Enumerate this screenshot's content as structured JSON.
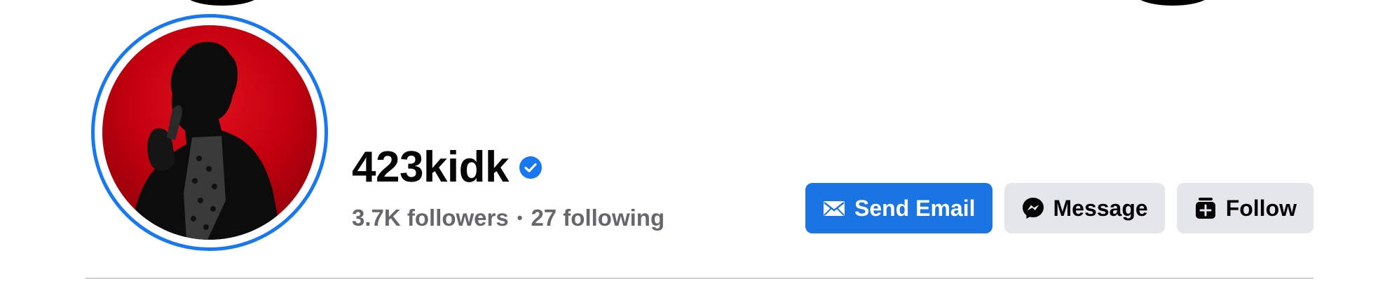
{
  "profile": {
    "name": "423kidk",
    "verified_icon": "verified-badge-icon",
    "followers": "3.7K followers",
    "separator": "•",
    "following": "27 following"
  },
  "actions": {
    "send_email": {
      "label": "Send Email",
      "icon": "envelope-icon"
    },
    "message": {
      "label": "Message",
      "icon": "messenger-icon"
    },
    "follow": {
      "label": "Follow",
      "icon": "follow-icon"
    }
  },
  "colors": {
    "accent": "#1b74e4",
    "ring": "#1877f2",
    "secondary_button": "#e4e6eb",
    "muted_text": "#65676b"
  }
}
